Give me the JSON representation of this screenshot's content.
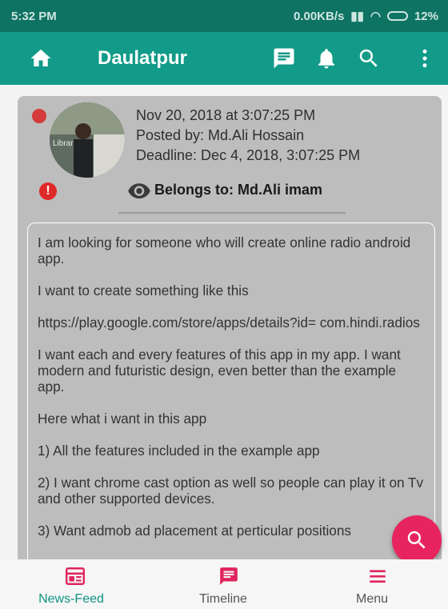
{
  "status_bar": {
    "time": "5:32 PM",
    "speed": "0.00KB/s",
    "battery": "12%"
  },
  "app_bar": {
    "title": "Daulatpur"
  },
  "post": {
    "date": "Nov 20, 2018 at 3:07:25 PM",
    "posted_by": "Posted by: Md.Ali Hossain",
    "deadline": "Deadline: Dec 4, 2018, 3:07:25 PM",
    "belongs_to": "Belongs to: Md.Ali imam",
    "avatar_text": "Librar",
    "paragraphs": [
      "I am looking for someone who will create online radio android app.",
      "I want to create something like this",
      "https://play.google.com/store/apps/details?id= com.hindi.radios",
      "I want each and every features of this app in my app. I want modern and futuristic design, even better than the example app.",
      "Here what i want in this app",
      "1) All the features included in the example app",
      "2) I want chrome cast option as well so people can play it on Tv and other supported devices.",
      "3) Want admob ad placement at perticular positions"
    ]
  },
  "bottom_nav": [
    {
      "label": "News-Feed"
    },
    {
      "label": "Timeline"
    },
    {
      "label": "Menu"
    }
  ],
  "colors": {
    "primary": "#119b88",
    "status": "#0f7363",
    "fab": "#e8245f",
    "accent_pink": "#e0245e",
    "active_nav": "#0f9483"
  }
}
